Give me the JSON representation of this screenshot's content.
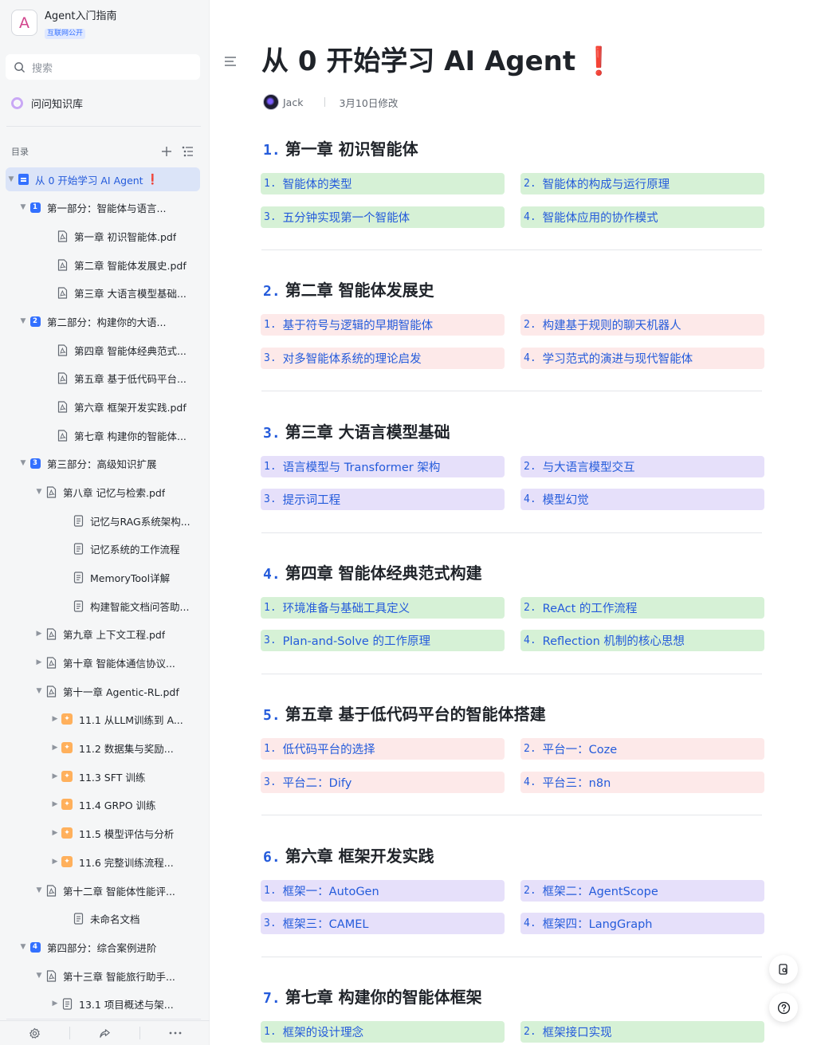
{
  "sidebar": {
    "kb_logo": "A",
    "kb_title": "Agent入门指南",
    "kb_badge": "互联网公开",
    "search_placeholder": "搜索",
    "ask_label": "问问知识库",
    "toc_label": "目录",
    "tree": [
      {
        "label": "从 0 开始学习 AI Agent",
        "suffix": "❗",
        "icon": "doc-blue",
        "caret": "▼",
        "active": true
      },
      {
        "label": "第一部分：智能体与语言...",
        "icon": "num-badge",
        "badge": "1",
        "caret": "▼"
      },
      {
        "label": "第一章 初识智能体.pdf",
        "icon": "pdf-icon",
        "caret": ""
      },
      {
        "label": "第二章 智能体发展史.pdf",
        "icon": "pdf-icon",
        "caret": ""
      },
      {
        "label": "第三章 大语言模型基础...",
        "icon": "pdf-icon",
        "caret": ""
      },
      {
        "label": "第二部分：构建你的大语...",
        "icon": "num-badge",
        "badge": "2",
        "caret": "▼"
      },
      {
        "label": "第四章 智能体经典范式...",
        "icon": "pdf-icon",
        "caret": ""
      },
      {
        "label": "第五章 基于低代码平台...",
        "icon": "pdf-icon",
        "caret": ""
      },
      {
        "label": "第六章 框架开发实践.pdf",
        "icon": "pdf-icon",
        "caret": ""
      },
      {
        "label": "第七章 构建你的智能体...",
        "icon": "pdf-icon",
        "caret": ""
      },
      {
        "label": "第三部分：高级知识扩展",
        "icon": "num-badge",
        "badge": "3",
        "caret": "▼"
      },
      {
        "label": "第八章 记忆与检索.pdf",
        "icon": "pdf-icon",
        "caret": "▼"
      },
      {
        "label": "记忆与RAG系统架构...",
        "icon": "doc-icon",
        "caret": ""
      },
      {
        "label": "记忆系统的工作流程",
        "icon": "doc-icon",
        "caret": ""
      },
      {
        "label": "MemoryTool详解",
        "icon": "doc-icon",
        "caret": ""
      },
      {
        "label": "构建智能文档问答助...",
        "icon": "doc-icon",
        "caret": ""
      },
      {
        "label": "第九章 上下文工程.pdf",
        "icon": "pdf-icon",
        "caret": "▶"
      },
      {
        "label": "第十章 智能体通信协议...",
        "icon": "pdf-icon",
        "caret": "▶"
      },
      {
        "label": "第十一章 Agentic-RL.pdf",
        "icon": "pdf-icon",
        "caret": "▼"
      },
      {
        "label": "11.1 从LLM训练到 A...",
        "icon": "star-badge",
        "caret": "▶"
      },
      {
        "label": "11.2 数据集与奖励...",
        "icon": "star-badge",
        "caret": "▶"
      },
      {
        "label": "11.3 SFT 训练",
        "icon": "star-badge",
        "caret": "▶"
      },
      {
        "label": "11.4 GRPO 训练",
        "icon": "star-badge",
        "caret": "▶"
      },
      {
        "label": "11.5 模型评估与分析",
        "icon": "star-badge",
        "caret": "▶"
      },
      {
        "label": "11.6 完整训练流程...",
        "icon": "star-badge",
        "caret": "▶"
      },
      {
        "label": "第十二章 智能体性能评...",
        "icon": "pdf-icon",
        "caret": "▼"
      },
      {
        "label": "未命名文档",
        "icon": "doc-icon",
        "caret": ""
      },
      {
        "label": "第四部分：综合案例进阶",
        "icon": "num-badge",
        "badge": "4",
        "caret": "▼"
      },
      {
        "label": "第十三章 智能旅行助手...",
        "icon": "pdf-icon",
        "caret": "▼"
      },
      {
        "label": "13.1 项目概述与架...",
        "icon": "doc-icon",
        "caret": "▶"
      }
    ]
  },
  "main": {
    "title": "从 0 开始学习 AI Agent",
    "title_suffix": "❗",
    "author": "Jack",
    "modified": "3月10日修改",
    "chapters": [
      {
        "num": "1.",
        "title": "第一章 初识智能体",
        "color": "green",
        "items": [
          {
            "num": "1.",
            "label": "智能体的类型"
          },
          {
            "num": "2.",
            "label": "智能体的构成与运行原理"
          },
          {
            "num": "3.",
            "label": "五分钟实现第一个智能体"
          },
          {
            "num": "4.",
            "label": "智能体应用的协作模式"
          }
        ]
      },
      {
        "num": "2.",
        "title": "第二章 智能体发展史",
        "color": "red",
        "items": [
          {
            "num": "1.",
            "label": "基于符号与逻辑的早期智能体"
          },
          {
            "num": "2.",
            "label": "构建基于规则的聊天机器人"
          },
          {
            "num": "3.",
            "label": "对多智能体系统的理论启发"
          },
          {
            "num": "4.",
            "label": "学习范式的演进与现代智能体"
          }
        ]
      },
      {
        "num": "3.",
        "title": "第三章 大语言模型基础",
        "color": "purple",
        "items": [
          {
            "num": "1.",
            "label": "语言模型与 Transformer 架构"
          },
          {
            "num": "2.",
            "label": "与大语言模型交互"
          },
          {
            "num": "3.",
            "label": "提示词工程"
          },
          {
            "num": "4.",
            "label": "模型幻觉"
          }
        ]
      },
      {
        "num": "4.",
        "title": "第四章 智能体经典范式构建",
        "color": "green",
        "items": [
          {
            "num": "1.",
            "label": "环境准备与基础工具定义"
          },
          {
            "num": "2.",
            "label": "ReAct 的工作流程"
          },
          {
            "num": "3.",
            "label": "Plan-and-Solve 的工作原理"
          },
          {
            "num": "4.",
            "label": "Reflection 机制的核心思想"
          }
        ]
      },
      {
        "num": "5.",
        "title": "第五章 基于低代码平台的智能体搭建",
        "color": "red",
        "items": [
          {
            "num": "1.",
            "label": "低代码平台的选择"
          },
          {
            "num": "2.",
            "label": "平台一：Coze"
          },
          {
            "num": "3.",
            "label": "平台二：Dify"
          },
          {
            "num": "4.",
            "label": "平台三：n8n"
          }
        ]
      },
      {
        "num": "6.",
        "title": "第六章 框架开发实践",
        "color": "purple",
        "items": [
          {
            "num": "1.",
            "label": "框架一：AutoGen"
          },
          {
            "num": "2.",
            "label": "框架二：AgentScope"
          },
          {
            "num": "3.",
            "label": "框架三：CAMEL"
          },
          {
            "num": "4.",
            "label": "框架四：LangGraph"
          }
        ]
      },
      {
        "num": "7.",
        "title": "第七章 构建你的智能体框架",
        "color": "green",
        "items": [
          {
            "num": "1.",
            "label": "框架的设计理念"
          },
          {
            "num": "2.",
            "label": "框架接口实现"
          }
        ]
      }
    ]
  },
  "colors": {
    "accent": "#245bdb",
    "card_green": "#d6f1d6",
    "card_red": "#fde9e9",
    "card_purple": "#e6e0fa",
    "exclaim": "#e8313a"
  }
}
